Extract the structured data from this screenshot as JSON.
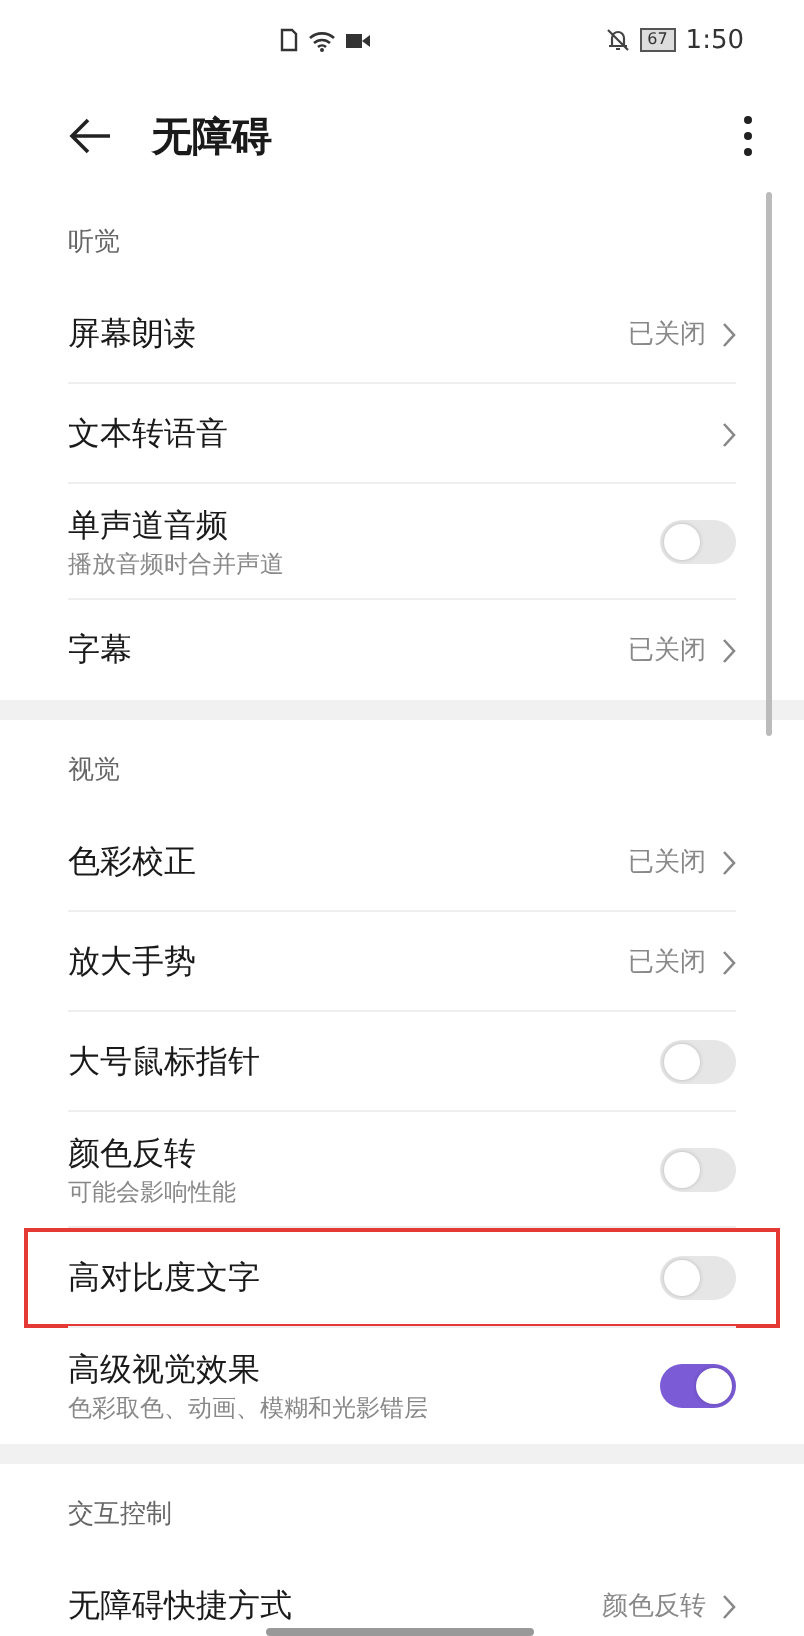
{
  "status_bar": {
    "time": "1:50",
    "battery": "67"
  },
  "header": {
    "title": "无障碍"
  },
  "sections": [
    {
      "label": "听觉",
      "items": [
        {
          "kind": "value",
          "title": "屏幕朗读",
          "value": "已关闭",
          "highlighted": false
        },
        {
          "kind": "link",
          "title": "文本转语音",
          "highlighted": false
        },
        {
          "kind": "switch",
          "title": "单声道音频",
          "subtitle": "播放音频时合并声道",
          "on": false,
          "highlighted": false
        },
        {
          "kind": "value",
          "title": "字幕",
          "value": "已关闭",
          "highlighted": false
        }
      ]
    },
    {
      "label": "视觉",
      "items": [
        {
          "kind": "value",
          "title": "色彩校正",
          "value": "已关闭",
          "highlighted": false
        },
        {
          "kind": "value",
          "title": "放大手势",
          "value": "已关闭",
          "highlighted": false
        },
        {
          "kind": "switch",
          "title": "大号鼠标指针",
          "on": false,
          "highlighted": false
        },
        {
          "kind": "switch",
          "title": "颜色反转",
          "subtitle": "可能会影响性能",
          "on": false,
          "highlighted": false
        },
        {
          "kind": "switch",
          "title": "高对比度文字",
          "on": false,
          "highlighted": true
        },
        {
          "kind": "switch",
          "title": "高级视觉效果",
          "subtitle": "色彩取色、动画、模糊和光影错层",
          "on": true,
          "highlighted": false
        }
      ]
    },
    {
      "label": "交互控制",
      "items": [
        {
          "kind": "value",
          "title": "无障碍快捷方式",
          "value": "颜色反转",
          "highlighted": false
        }
      ]
    }
  ]
}
